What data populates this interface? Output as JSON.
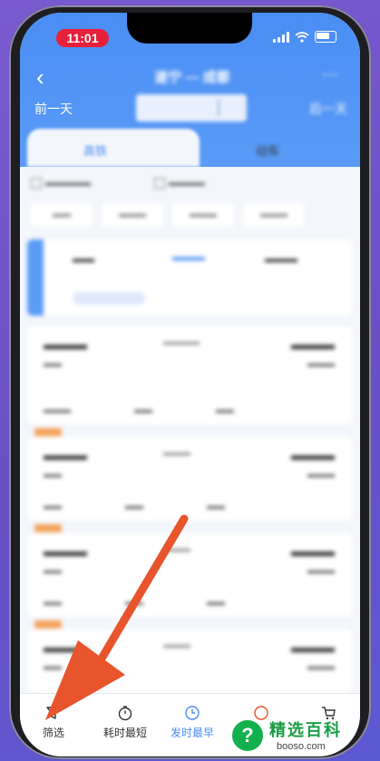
{
  "status_bar": {
    "time": "11:01"
  },
  "header": {
    "back_glyph": "‹",
    "route_title": "遂宁 — 成都",
    "prev_day_label": "前一天",
    "date_text": "",
    "next_day_label": "后一天"
  },
  "mode_tabs": [
    {
      "label": "高铁",
      "active": true
    },
    {
      "label": "动车",
      "active": false
    }
  ],
  "bottom_tabs": [
    {
      "label": "筛选",
      "icon": "filter-icon"
    },
    {
      "label": "耗时最短",
      "icon": "timer-icon"
    },
    {
      "label": "发时最早",
      "icon": "clock-icon",
      "active": true
    }
  ],
  "watermark": {
    "title": "精选百科",
    "url": "booso.com",
    "logo_glyph": "?"
  },
  "colors": {
    "accent": "#4a8df4",
    "arrow": "#e8542b",
    "status_red": "#e6203a"
  }
}
